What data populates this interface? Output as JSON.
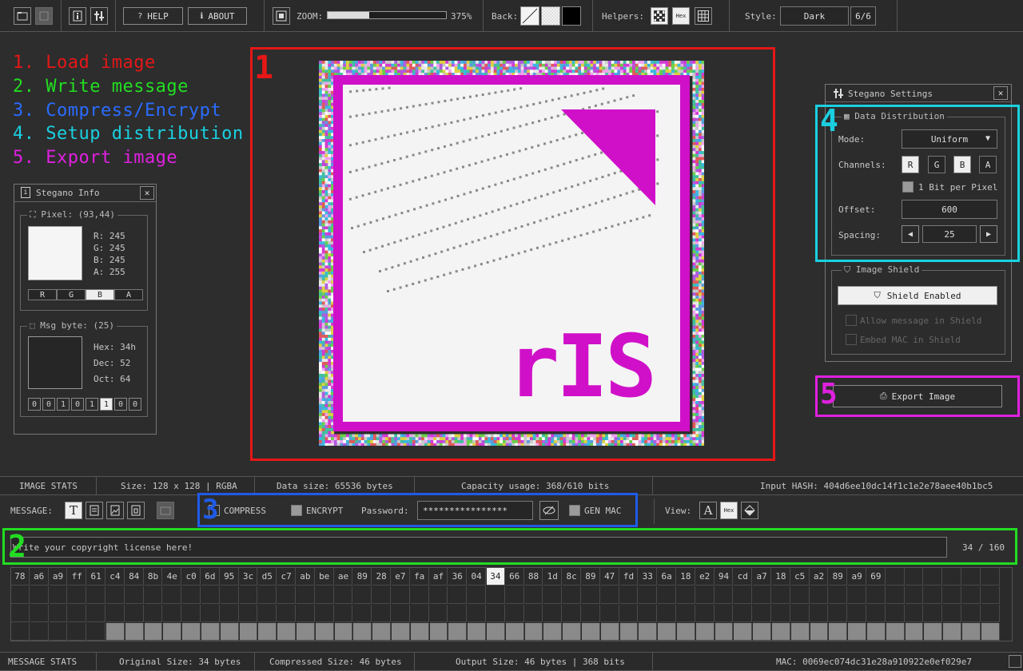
{
  "toolbar": {
    "help": "HELP",
    "about": "ABOUT",
    "zoom_label": "ZOOM:",
    "zoom_value": "375%",
    "zoom_level": 0.35,
    "back_label": "Back:",
    "helpers_label": "Helpers:",
    "hex_label": "Hex",
    "style_label": "Style:",
    "style_value": "Dark",
    "style_count": "6/6"
  },
  "steps": [
    {
      "text": "1. Load image",
      "color": "#e51717"
    },
    {
      "text": "2. Write message",
      "color": "#22dd22"
    },
    {
      "text": "3. Compress/Encrypt",
      "color": "#2a6cff"
    },
    {
      "text": "4. Setup distribution",
      "color": "#1ad0e0"
    },
    {
      "text": "5. Export image",
      "color": "#e020e0"
    }
  ],
  "markers": {
    "m1": "1",
    "m2": "2",
    "m3": "3",
    "m4": "4",
    "m5": "5"
  },
  "info_panel": {
    "title": "Stegano Info",
    "pixel_title": "Pixel: (93,44)",
    "r": "R: 245",
    "g": "G: 245",
    "b": "B: 245",
    "a": "A: 255",
    "channels": [
      "R",
      "G",
      "B",
      "A"
    ],
    "msg_title": "Msg byte: (25)",
    "hex": "Hex: 34h",
    "dec": "Dec: 52",
    "oct": "Oct: 64",
    "bits": [
      "0",
      "0",
      "1",
      "0",
      "1",
      "1",
      "0",
      "0"
    ]
  },
  "canvas": {
    "logo_text": "rIS",
    "accent": "#d010c8"
  },
  "settings": {
    "title": "Stegano Settings",
    "dist_title": "Data Distribution",
    "mode_label": "Mode:",
    "mode_value": "Uniform",
    "channels_label": "Channels:",
    "channels": [
      "R",
      "G",
      "B",
      "A"
    ],
    "bpp_label": "1 Bit per Pixel",
    "offset_label": "Offset:",
    "offset_value": "600",
    "spacing_label": "Spacing:",
    "spacing_value": "25",
    "shield_title": "Image Shield",
    "shield_button": "Shield Enabled",
    "allow_msg": "Allow message in Shield",
    "embed_mac": "Embed MAC in Shield",
    "export_button": "Export Image"
  },
  "image_stats": {
    "label": "IMAGE STATS",
    "size": "Size:  128 x 128 | RGBA",
    "data_size": "Data size:  65536 bytes",
    "capacity": "Capacity usage:  368/610 bits",
    "hash": "Input HASH: 404d6ee10dc14f1c1e2e78aee40b1bc5"
  },
  "message_bar": {
    "label": "MESSAGE:",
    "compress": "COMPRESS",
    "encrypt": "ENCRYPT",
    "password_label": "Password:",
    "password_value": "****************",
    "genmac": "GEN MAC",
    "view_label": "View:",
    "view_hex": "Hex"
  },
  "message": {
    "text": "Write your copyright license here!",
    "count": "34 / 160"
  },
  "hex_bytes": [
    "78",
    "a6",
    "a9",
    "ff",
    "61",
    "c4",
    "84",
    "8b",
    "4e",
    "c0",
    "6d",
    "95",
    "3c",
    "d5",
    "c7",
    "ab",
    "be",
    "ae",
    "89",
    "28",
    "e7",
    "fa",
    "af",
    "36",
    "04",
    "34",
    "66",
    "88",
    "1d",
    "8c",
    "89",
    "47",
    "fd",
    "33",
    "6a",
    "18",
    "e2",
    "94",
    "cd",
    "a7",
    "18",
    "c5",
    "a2",
    "89",
    "a9",
    "69"
  ],
  "message_stats": {
    "label": "MESSAGE STATS",
    "original": "Original Size: 34 bytes",
    "compressed": "Compressed Size: 46 bytes",
    "output": "Output Size: 46 bytes | 368 bits",
    "mac": "MAC: 0069ec074dc31e28a910922e0ef029e7"
  }
}
